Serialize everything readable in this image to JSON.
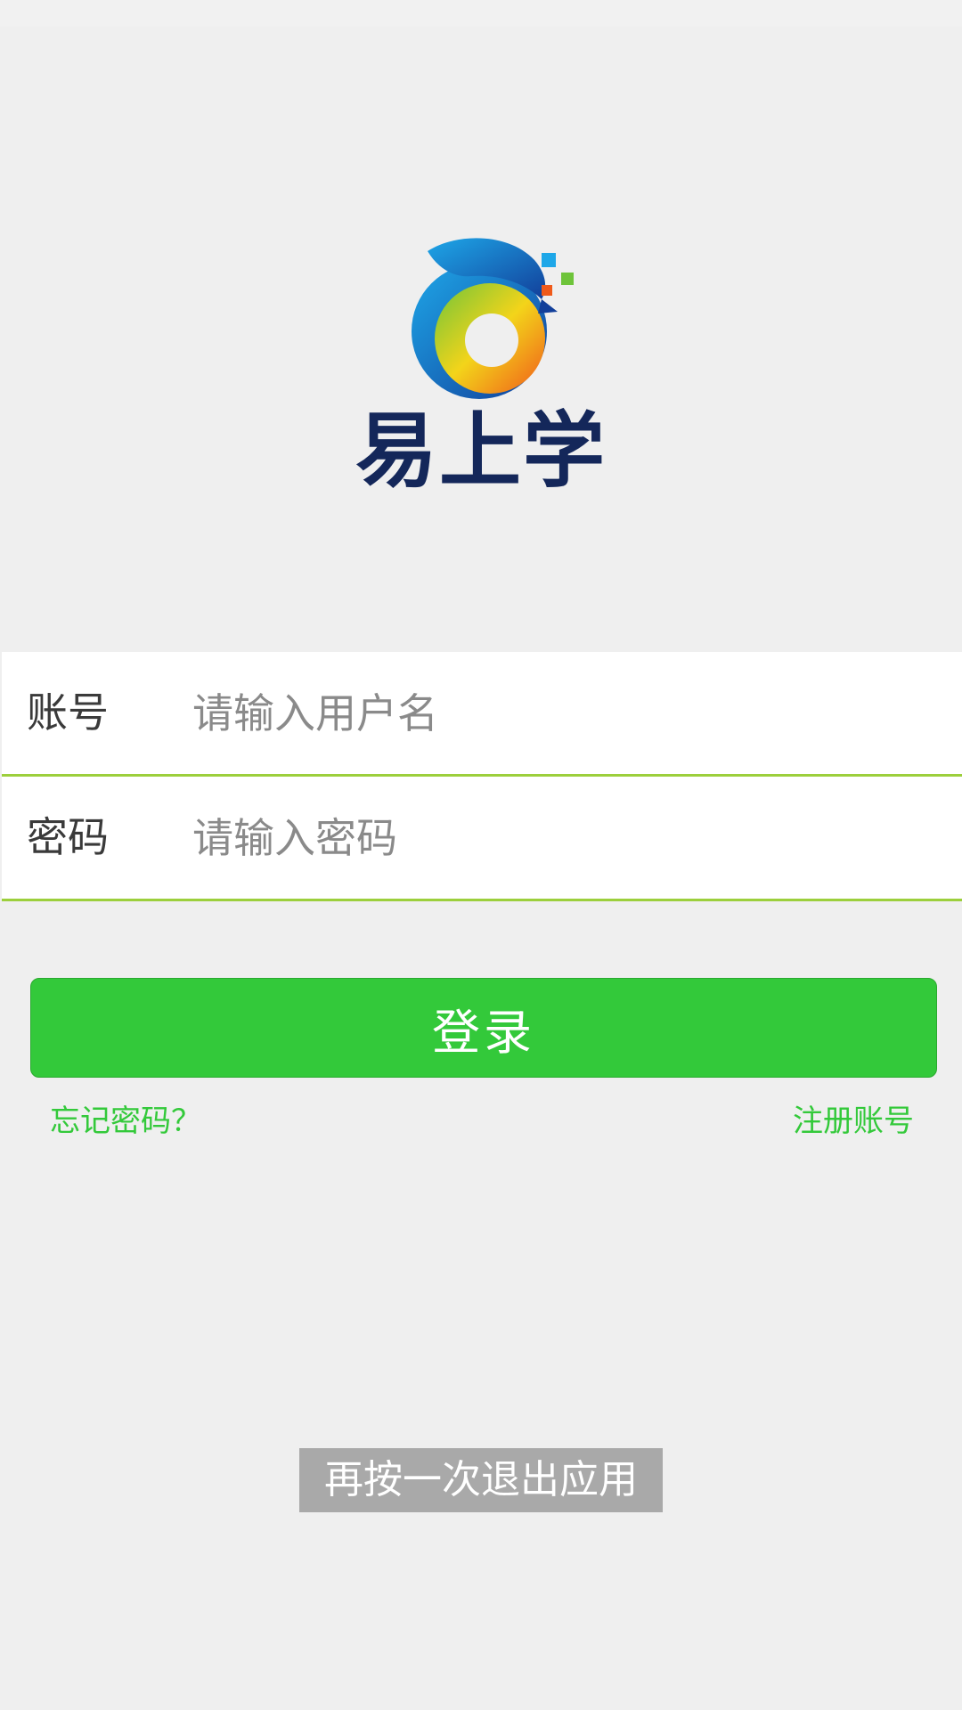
{
  "app": {
    "name": "易上学",
    "logo_icon": "dolphin-logo-icon"
  },
  "form": {
    "username": {
      "label": "账号",
      "placeholder": "请输入用户名",
      "value": ""
    },
    "password": {
      "label": "密码",
      "placeholder": "请输入密码",
      "value": ""
    }
  },
  "actions": {
    "login_label": "登录",
    "forgot_password_label": "忘记密码？",
    "register_label": "注册账号"
  },
  "toast": {
    "message": "再按一次退出应用"
  },
  "colors": {
    "background": "#efefef",
    "accent_green": "#33c93a",
    "underline_green": "#9ccf3c",
    "logo_text": "#14275a",
    "toast_background": "#a9a9a9"
  }
}
